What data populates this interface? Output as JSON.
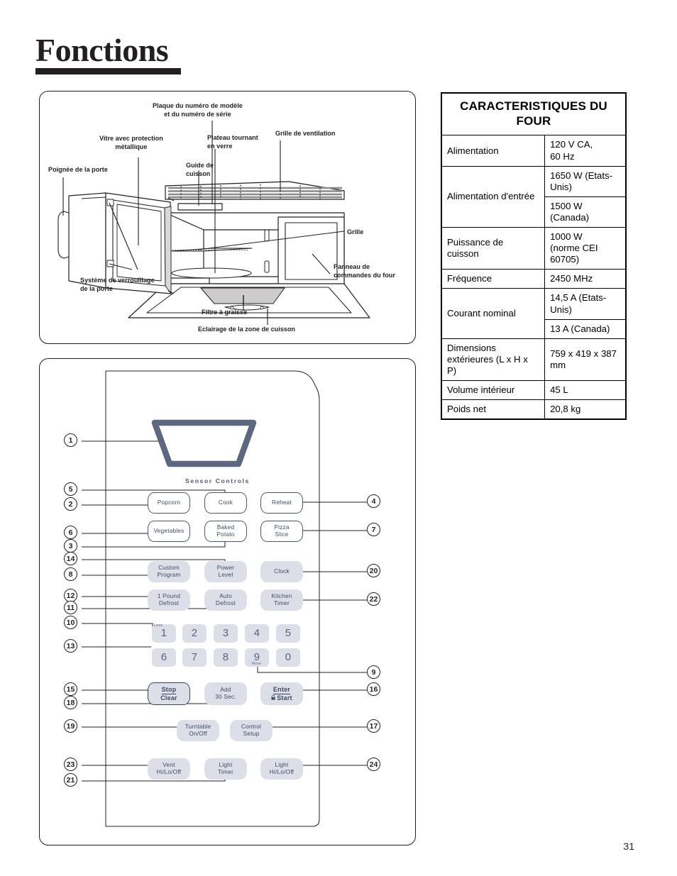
{
  "page": {
    "title": "Fonctions",
    "number": "31"
  },
  "spec_table": {
    "heading": "CARACTERISTIQUES DU FOUR",
    "rows": [
      {
        "label": "Alimentation",
        "values": [
          "120 V CA,",
          "60 Hz"
        ],
        "single_cell": true
      },
      {
        "label": "Alimentation d'entrée",
        "values": [
          "1650 W (Etats-Unis)",
          "1500 W (Canada)"
        ],
        "single_cell": false
      },
      {
        "label": "Puissance de cuisson",
        "values": [
          "1000 W",
          "(norme CEI 60705)"
        ],
        "single_cell": true
      },
      {
        "label": "Fréquence",
        "values": [
          "2450 MHz"
        ],
        "single_cell": true
      },
      {
        "label": "Courant nominal",
        "values": [
          "14,5 A (Etats-Unis)",
          "13 A (Canada)"
        ],
        "single_cell": false
      },
      {
        "label": "Dimensions extérieures (L x H x P)",
        "values": [
          "759 x 419 x 387 mm"
        ],
        "single_cell": true
      },
      {
        "label": "Volume intérieur",
        "values": [
          "45 L"
        ],
        "single_cell": true
      },
      {
        "label": "Poids net",
        "values": [
          "20,8 kg"
        ],
        "single_cell": true
      }
    ]
  },
  "oven_diagram": {
    "labels": [
      {
        "id": "model-serial-plate",
        "text_lines": [
          "Plaque du numéro de modèle",
          "et du numéro de série"
        ]
      },
      {
        "id": "metal-shield-window",
        "text_lines": [
          "Vitre avec protection",
          "métallique"
        ]
      },
      {
        "id": "glass-turntable",
        "text_lines": [
          "Plateau tournant",
          "en verre"
        ]
      },
      {
        "id": "vent-grille",
        "text_lines": [
          "Grille de ventilation"
        ]
      },
      {
        "id": "cooking-guide",
        "text_lines": [
          "Guide de",
          "cuisson"
        ]
      },
      {
        "id": "door-handle",
        "text_lines": [
          "Poignée de la porte"
        ]
      },
      {
        "id": "rack",
        "text_lines": [
          "Grille"
        ]
      },
      {
        "id": "oven-control-panel",
        "text_lines": [
          "Panneau de",
          "commandes du four"
        ]
      },
      {
        "id": "door-latch-system",
        "text_lines": [
          "Système de verrouillage",
          "de la porte"
        ]
      },
      {
        "id": "grease-filter",
        "text_lines": [
          "Filtre à graisse"
        ]
      },
      {
        "id": "cooktop-light",
        "text_lines": [
          "Eclairage de la zone de cuisson"
        ]
      }
    ]
  },
  "control_panel": {
    "sensor_heading": "Sensor Controls",
    "buttons": [
      {
        "id": "popcorn",
        "lines": [
          "Popcorn"
        ]
      },
      {
        "id": "cook",
        "lines": [
          "Cook"
        ]
      },
      {
        "id": "reheat",
        "lines": [
          "Reheat"
        ]
      },
      {
        "id": "vegetables",
        "lines": [
          "Vegetables"
        ]
      },
      {
        "id": "baked-potato",
        "lines": [
          "Baked",
          "Potato"
        ]
      },
      {
        "id": "pizza-slice",
        "lines": [
          "Pizza",
          "Slice"
        ]
      },
      {
        "id": "custom-program",
        "lines": [
          "Custom",
          "Program"
        ]
      },
      {
        "id": "power-level",
        "lines": [
          "Power",
          "Level"
        ]
      },
      {
        "id": "clock",
        "lines": [
          "Clock"
        ]
      },
      {
        "id": "one-pound-defrost",
        "lines": [
          "1 Pound",
          "Defrost"
        ]
      },
      {
        "id": "auto-defrost",
        "lines": [
          "Auto",
          "Defrost"
        ]
      },
      {
        "id": "kitchen-timer",
        "lines": [
          "Kitchen",
          "Timer"
        ]
      },
      {
        "id": "add-30-sec",
        "lines": [
          "Add",
          "30 Sec."
        ]
      },
      {
        "id": "turntable-on-off",
        "lines": [
          "Turntable",
          "On/Off"
        ]
      },
      {
        "id": "control-setup",
        "lines": [
          "Control",
          "Setup"
        ]
      },
      {
        "id": "vent-hi-lo-off",
        "lines": [
          "Vent",
          "Hi/Lo/Off"
        ]
      },
      {
        "id": "light-timer",
        "lines": [
          "Light",
          "Timer"
        ]
      },
      {
        "id": "light-hi-lo-off",
        "lines": [
          "Light",
          "Hi/Lo/Off"
        ]
      }
    ],
    "stop_clear": {
      "top": "Stop",
      "bottom": "Clear"
    },
    "enter_start": {
      "top": "Enter",
      "bottom": "Start",
      "icon": "lock-icon"
    },
    "keypad": {
      "row1": [
        "1",
        "2",
        "3",
        "4",
        "5"
      ],
      "row2": [
        "6",
        "7",
        "8",
        "9",
        "0"
      ],
      "less_label": "Less",
      "more_label": "More"
    },
    "callouts_left": [
      "1",
      "5",
      "2",
      "6",
      "3",
      "14",
      "8",
      "12",
      "11",
      "10",
      "13",
      "15",
      "18",
      "19",
      "23",
      "21"
    ],
    "callouts_right": [
      "4",
      "7",
      "20",
      "22",
      "9",
      "16",
      "17",
      "24"
    ]
  },
  "colors": {
    "ink": "#231f20",
    "panel_blue": "#4b5672",
    "key_fill": "#dcdfe8",
    "display_bezel": "#5d6880"
  }
}
